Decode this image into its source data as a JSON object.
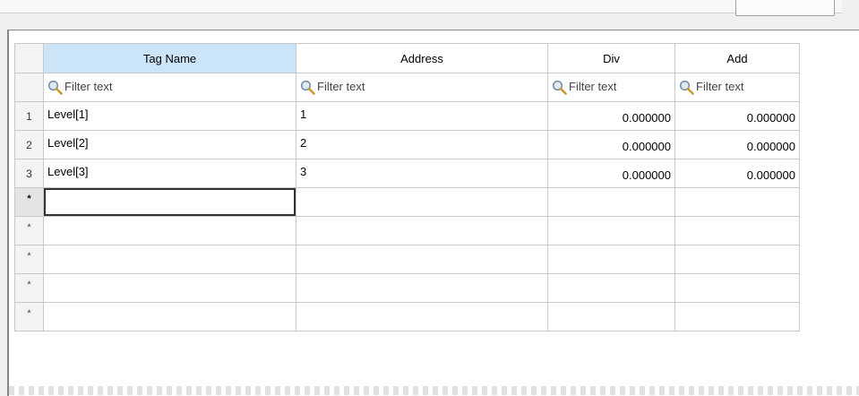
{
  "columns": {
    "tag_name": "Tag Name",
    "address": "Address",
    "div": "Div",
    "add": "Add"
  },
  "filter": {
    "placeholder": "Filter text",
    "icon": "magnifier-icon"
  },
  "rows": [
    {
      "index": "1",
      "tag": "Level[1]",
      "address": "1",
      "div": "0.000000",
      "add": "0.000000"
    },
    {
      "index": "2",
      "tag": "Level[2]",
      "address": "2",
      "div": "0.000000",
      "add": "0.000000"
    },
    {
      "index": "3",
      "tag": "Level[3]",
      "address": "3",
      "div": "0.000000",
      "add": "0.000000"
    }
  ],
  "new_row_marker": "*",
  "colors": {
    "selected_header": "#cce4f7",
    "grid_line": "#c8c8c8",
    "row_header_bg": "#f3f3f3"
  }
}
